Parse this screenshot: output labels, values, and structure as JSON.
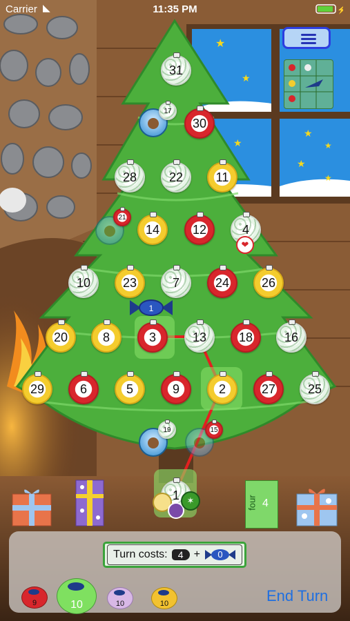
{
  "status_bar": {
    "carrier": "Carrier",
    "time": "11:35 PM"
  },
  "board": {
    "ornaments": [
      {
        "n": "31",
        "color": "white"
      },
      {
        "n": "30",
        "color": "red"
      },
      {
        "n": "28",
        "color": "white"
      },
      {
        "n": "22",
        "color": "white"
      },
      {
        "n": "11",
        "color": "yellow"
      },
      {
        "n": "14",
        "color": "yellow"
      },
      {
        "n": "12",
        "color": "red"
      },
      {
        "n": "4",
        "color": "white"
      },
      {
        "n": "10",
        "color": "white"
      },
      {
        "n": "23",
        "color": "yellow"
      },
      {
        "n": "7",
        "color": "white"
      },
      {
        "n": "24",
        "color": "red"
      },
      {
        "n": "26",
        "color": "yellow"
      },
      {
        "n": "20",
        "color": "yellow"
      },
      {
        "n": "8",
        "color": "yellow"
      },
      {
        "n": "3",
        "color": "red"
      },
      {
        "n": "13",
        "color": "white"
      },
      {
        "n": "18",
        "color": "red"
      },
      {
        "n": "16",
        "color": "white"
      },
      {
        "n": "29",
        "color": "yellow"
      },
      {
        "n": "6",
        "color": "red"
      },
      {
        "n": "5",
        "color": "yellow"
      },
      {
        "n": "9",
        "color": "red"
      },
      {
        "n": "2",
        "color": "yellow"
      },
      {
        "n": "27",
        "color": "red"
      },
      {
        "n": "25",
        "color": "white"
      },
      {
        "n": "1",
        "color": "white"
      }
    ],
    "small_ornaments": [
      "17",
      "21",
      "19",
      "15"
    ],
    "candy_marker": "1",
    "gift_label": "four",
    "gift_number": "4"
  },
  "turn_costs": {
    "label": "Turn costs:",
    "steps": "4",
    "plus": "+",
    "candy": "0"
  },
  "players": [
    {
      "count": "9",
      "color": "#d8262c"
    },
    {
      "count": "10",
      "color": "#7fe060"
    },
    {
      "count": "10",
      "color": "#d8b8e6"
    },
    {
      "count": "10",
      "color": "#f2c230"
    }
  ],
  "end_turn_label": "End Turn",
  "colors": {
    "tree": "#4caf3c",
    "window": "#2b8fe0",
    "wood": "#7a4a28",
    "accent": "#1f6fe0"
  }
}
